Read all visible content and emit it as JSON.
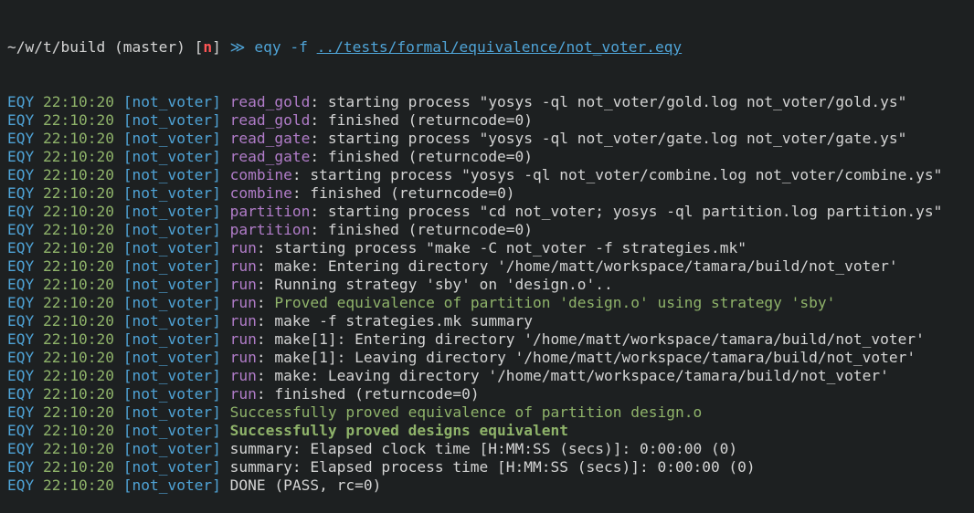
{
  "prompt": {
    "dir": "~/w/t/build",
    "branch": "(master)",
    "mode": "n",
    "arrow": "≫",
    "command": "eqy -f",
    "path": "../tests/formal/equivalence/not_voter.eqy"
  },
  "log_prefix": {
    "tool": "EQY",
    "time": "22:10:20",
    "job": "[not_voter]"
  },
  "log_lines": [
    {
      "task": "read_gold",
      "msg": "starting process \"yosys -ql not_voter/gold.log not_voter/gold.ys\"",
      "style": "normal"
    },
    {
      "task": "read_gold",
      "msg": "finished (returncode=0)",
      "style": "normal"
    },
    {
      "task": "read_gate",
      "msg": "starting process \"yosys -ql not_voter/gate.log not_voter/gate.ys\"",
      "style": "normal"
    },
    {
      "task": "read_gate",
      "msg": "finished (returncode=0)",
      "style": "normal"
    },
    {
      "task": "combine",
      "msg": "starting process \"yosys -ql not_voter/combine.log not_voter/combine.ys\"",
      "style": "normal"
    },
    {
      "task": "combine",
      "msg": "finished (returncode=0)",
      "style": "normal"
    },
    {
      "task": "partition",
      "msg": "starting process \"cd not_voter; yosys -ql partition.log partition.ys\"",
      "style": "normal"
    },
    {
      "task": "partition",
      "msg": "finished (returncode=0)",
      "style": "normal"
    },
    {
      "task": "run",
      "msg": "starting process \"make -C not_voter -f strategies.mk\"",
      "style": "normal"
    },
    {
      "task": "run",
      "msg": "make: Entering directory '/home/matt/workspace/tamara/build/not_voter'",
      "style": "normal"
    },
    {
      "task": "run",
      "msg": "Running strategy 'sby' on 'design.o'..",
      "style": "normal"
    },
    {
      "task": "run",
      "msg": "Proved equivalence of partition 'design.o' using strategy 'sby'",
      "style": "green"
    },
    {
      "task": "run",
      "msg": "make -f strategies.mk summary",
      "style": "normal"
    },
    {
      "task": "run",
      "msg": "make[1]: Entering directory '/home/matt/workspace/tamara/build/not_voter'",
      "style": "normal"
    },
    {
      "task": "run",
      "msg": "make[1]: Leaving directory '/home/matt/workspace/tamara/build/not_voter'",
      "style": "normal"
    },
    {
      "task": "run",
      "msg": "make: Leaving directory '/home/matt/workspace/tamara/build/not_voter'",
      "style": "normal"
    },
    {
      "task": "run",
      "msg": "finished (returncode=0)",
      "style": "normal"
    },
    {
      "task": "",
      "msg": "Successfully proved equivalence of partition design.o",
      "style": "green"
    },
    {
      "task": "",
      "msg": "Successfully proved designs equivalent",
      "style": "green-bold"
    },
    {
      "task": "",
      "msg": "summary: Elapsed clock time [H:MM:SS (secs)]: 0:00:00 (0)",
      "style": "normal"
    },
    {
      "task": "",
      "msg": "summary: Elapsed process time [H:MM:SS (secs)]: 0:00:00 (0)",
      "style": "normal"
    },
    {
      "task": "",
      "msg": "DONE (PASS, rc=0)",
      "style": "normal"
    }
  ],
  "colors": {
    "background": "#1d2021",
    "foreground": "#d4d4d4",
    "blue": "#4fa3d6",
    "green": "#8fb36a",
    "purple": "#b07cc8",
    "red": "#ff5555"
  }
}
